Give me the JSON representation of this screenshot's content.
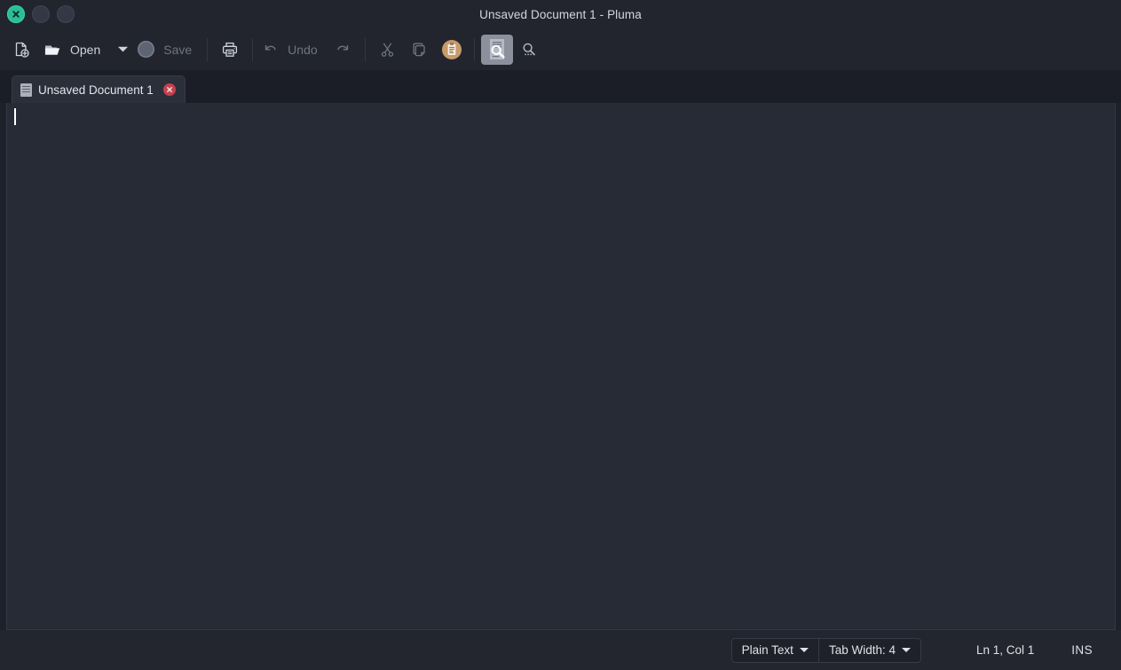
{
  "window": {
    "title": "Unsaved Document 1 - Pluma",
    "controls": {
      "close_label": "close-window",
      "minimize_label": "minimize-window",
      "maximize_label": "maximize-window"
    }
  },
  "toolbar": {
    "new_label": "New",
    "open_label": "Open",
    "open_dropdown_label": "Open recent",
    "save_label": "Save",
    "print_label": "Print",
    "undo_label": "Undo",
    "redo_label": "Redo",
    "cut_label": "Cut",
    "copy_label": "Copy",
    "paste_label": "Paste",
    "find_label": "Find",
    "replace_label": "Find and Replace"
  },
  "tabs": [
    {
      "title": "Unsaved Document 1",
      "close_label": "Close tab",
      "active": true
    }
  ],
  "editor": {
    "content": "",
    "cursor_visible": true
  },
  "statusbar": {
    "language": "Plain Text",
    "tab_width": "Tab Width: 4",
    "position": "Ln 1, Col 1",
    "insert_mode": "INS"
  },
  "colors": {
    "titlebar_bg": "#22252e",
    "toolbar_bg": "#22252e",
    "tabstrip_bg": "#1b1e26",
    "editor_bg": "#272b36",
    "statusbar_bg": "#23262f",
    "close_button": "#2bbd9a",
    "tab_close_button": "#c4414f",
    "paste_icon": "#c99a6a",
    "active_toggle": "#8b909c",
    "text_primary": "#dfe2e8",
    "text_disabled": "#6e7480"
  }
}
